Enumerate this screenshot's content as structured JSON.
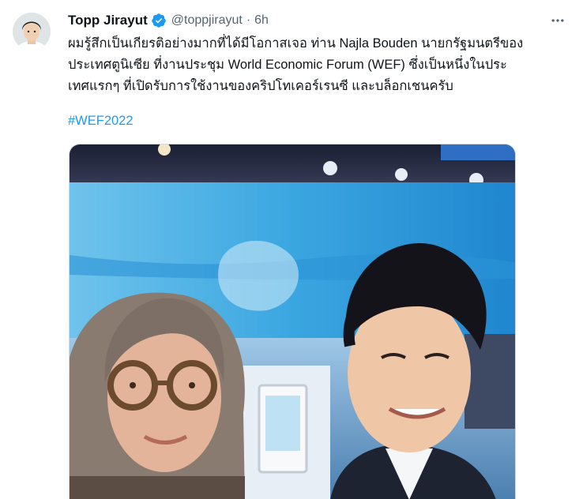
{
  "tweet": {
    "display_name": "Topp Jirayut",
    "handle": "@toppjirayut",
    "separator": "·",
    "time": "6h",
    "text_lines": [
      "ผมรู้สึกเป็นเกียรติอย่างมากที่ได้มีโอกาสเจอ ท่าน Najla Bouden นายกรัฐมนตรีของ",
      "ประเทศตูนิเซีย ที่งานประชุม World Economic Forum (WEF) ซึ่งเป็นหนึ่งในประ",
      "เทศแรกๆ ที่เปิดรับการใช้งานของคริปโทเคอร์เรนซี และบล็อกเชนครับ"
    ],
    "hashtag": "#WEF2022"
  },
  "icons": {
    "verified": "verified-badge-icon",
    "more": "more-horizontal-icon"
  },
  "colors": {
    "link": "#1d9bf0",
    "secondary_text": "#536471",
    "primary_text": "#0f1419",
    "verified": "#1d9bf0"
  }
}
